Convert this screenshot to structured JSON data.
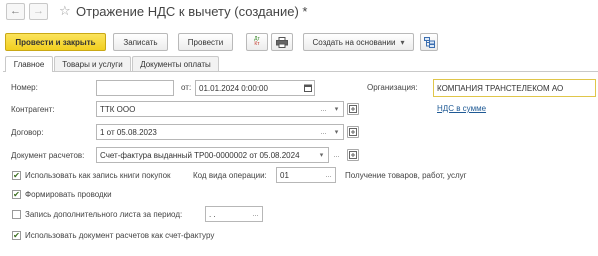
{
  "window": {
    "title": "Отражение НДС к вычету (создание) *",
    "back_icon": "←",
    "forward_icon": "→",
    "favorite_icon": "☆"
  },
  "toolbar": {
    "post_and_close_label": "Провести и закрыть",
    "save_label": "Записать",
    "post_label": "Провести",
    "dtkt_label_top": "Дт",
    "dtkt_label_bottom": "Кт",
    "create_based_on_label": "Создать на основании",
    "dropdown_arrow": "▾"
  },
  "tabs": [
    {
      "label": "Главное",
      "active": true
    },
    {
      "label": "Товары и услуги",
      "active": false
    },
    {
      "label": "Документы оплаты",
      "active": false
    }
  ],
  "form": {
    "number_label": "Номер:",
    "number_value": "",
    "date_label": "от:",
    "date_value": "01.01.2024  0:00:00",
    "organization_label": "Организация:",
    "organization_value": "КОМПАНИЯ ТРАНСТЕЛЕКОМ АО",
    "vat_link": "НДС в сумме",
    "counterparty_label": "Контрагент:",
    "counterparty_value": "ТТК ООО",
    "contract_label": "Договор:",
    "contract_value": "1 от 05.08.2023",
    "settlement_doc_label": "Документ расчетов:",
    "settlement_doc_value": "Счет-фактура выданный ТР00-0000002 от 05.08.2024 ",
    "use_for_purchase_book_label": "Использовать как запись книги покупок",
    "use_for_purchase_book_checked": true,
    "operation_code_label": "Код вида операции:",
    "operation_code_value": "01",
    "operation_description": "Получение товаров, работ, услуг",
    "generate_postings_label": "Формировать проводки",
    "generate_postings_checked": true,
    "additional_sheet_label": "Запись дополнительного листа за период:",
    "additional_sheet_checked": false,
    "additional_sheet_period_value": " .  .",
    "use_as_invoice_label": "Использовать документ расчетов как счет-фактуру",
    "use_as_invoice_checked": true,
    "dots_icon": "...",
    "dropdown_icon": "▾",
    "check_mark": "✔"
  }
}
